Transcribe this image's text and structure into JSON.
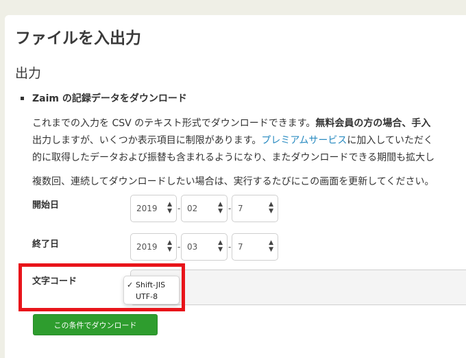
{
  "page": {
    "title": "ファイルを入出力",
    "section": "出力"
  },
  "export": {
    "item_title": "Zaim の記録データをダウンロード",
    "para1_line1_a": "これまでの入力を CSV のテキスト形式でダウンロードできます。",
    "para1_line1_b": "無料会員の方の場合、手入",
    "para1_line2_a": "出力しますが、いくつか表示項目に制限があります。",
    "para1_line2_link": "プレミアムサービス",
    "para1_line2_b": "に加入していただく",
    "para1_line3": "的に取得したデータおよび振替も含まれるようになり、またダウンロードできる期間も拡大し",
    "para2": "複数回、連続してダウンロードしたい場合は、実行するたびにこの画面を更新してください。"
  },
  "form": {
    "start_label": "開始日",
    "start": {
      "year": "2019",
      "month": "02",
      "day": "7"
    },
    "end_label": "終了日",
    "end": {
      "year": "2019",
      "month": "03",
      "day": "7"
    },
    "date_separator": "-",
    "encoding_label": "文字コード",
    "encoding_options": [
      {
        "label": "Shift-JIS",
        "checked": true
      },
      {
        "label": "UTF-8",
        "checked": false
      }
    ],
    "check_mark": "✓",
    "download_button": "この条件でダウンロード"
  },
  "colors": {
    "highlight": "#e8141a",
    "button": "#2e9d2e",
    "link": "#2a8bc1"
  }
}
